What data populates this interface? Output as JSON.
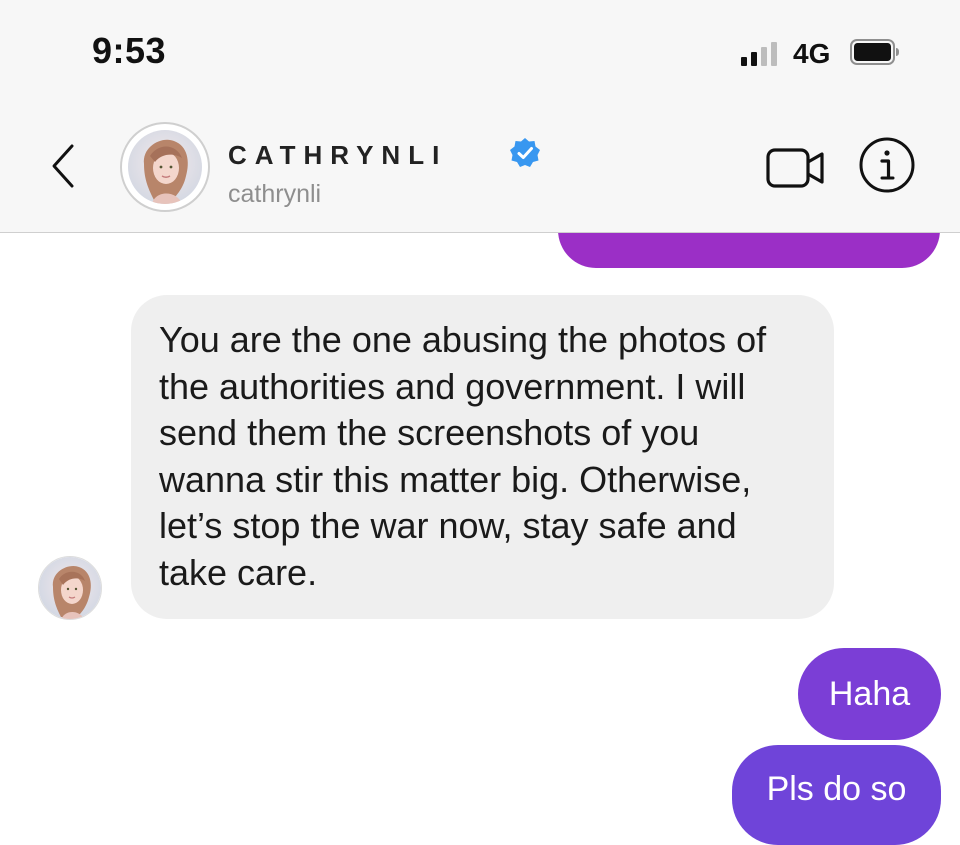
{
  "status_bar": {
    "time": "9:53",
    "network": "4G",
    "signal_bars_filled": 2,
    "signal_bars_total": 4
  },
  "header": {
    "display_name": "CATHRYNLI",
    "username": "cathrynli",
    "verified": true
  },
  "icons": {
    "back": "chevron-left-icon",
    "video": "video-camera-icon",
    "info": "info-icon",
    "verified": "verified-badge-icon",
    "battery": "battery-icon",
    "signal": "signal-icon"
  },
  "messages": [
    {
      "direction": "incoming",
      "text": "You are the one abusing the photos of the authorities and government. I will send them the screenshots of you wanna stir this matter big. Otherwise, let’s stop the war now, stay safe and take care."
    },
    {
      "direction": "outgoing",
      "text": "Haha"
    },
    {
      "direction": "outgoing",
      "text": "Pls do so"
    }
  ],
  "colors": {
    "header_bg": "#f7f7f7",
    "incoming_bubble": "#efefef",
    "outgoing_bubble_top": "#9b2fc6",
    "outgoing_bubble_mid": "#7b3ed6",
    "outgoing_bubble_bottom": "#6f44d9",
    "verified_blue": "#3897f0",
    "username_gray": "#8e8e8e"
  }
}
